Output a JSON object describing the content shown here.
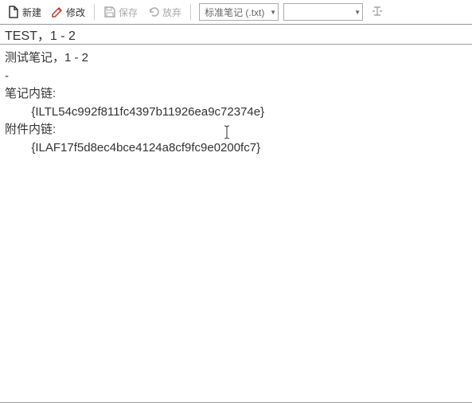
{
  "toolbar": {
    "new_label": "新建",
    "edit_label": "修改",
    "save_label": "保存",
    "discard_label": "放弃",
    "format_dropdown": "标准笔记 (.txt)",
    "second_dropdown": ""
  },
  "title": "TEST，1 - 2",
  "content": {
    "line1": "测试笔记，1 - 2",
    "line2": "-",
    "line3": "笔记内链:",
    "line4": "        {ILTL54c992f811fc4397b11926ea9c72374e}",
    "line5": "",
    "line6": "附件内链:",
    "line7": "        {ILAF17f5d8ec4bce4124a8cf9fc9e0200fc7}"
  }
}
